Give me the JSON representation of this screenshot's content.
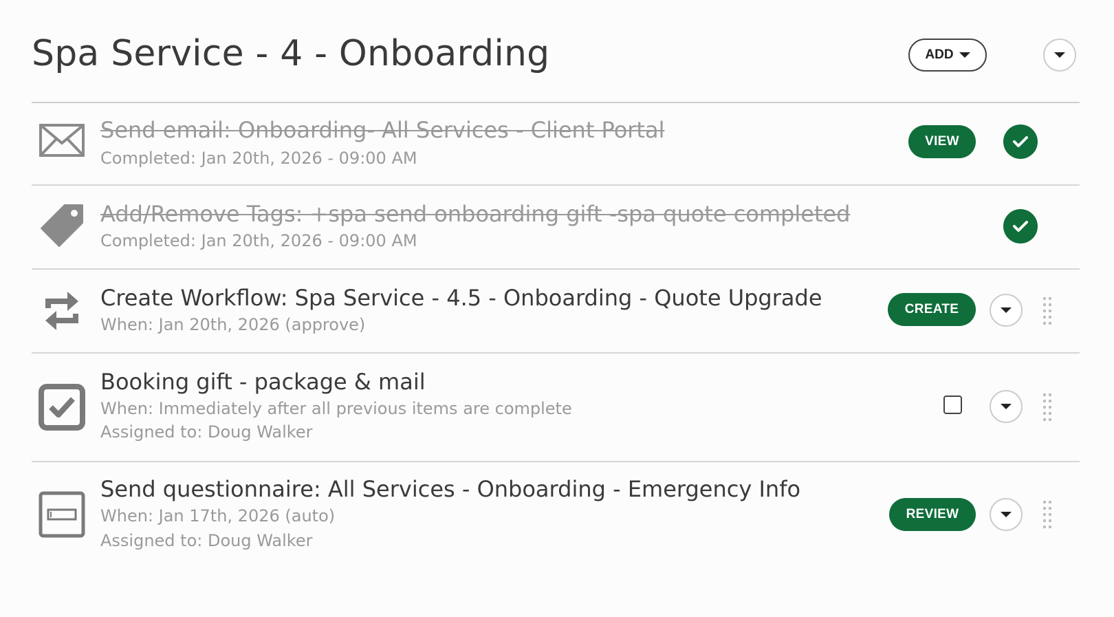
{
  "header": {
    "title": "Spa Service - 4 - Onboarding",
    "add_label": "ADD"
  },
  "colors": {
    "accent_green": "#0f6e3a",
    "completed_text": "#999999"
  },
  "items": [
    {
      "icon": "envelope-icon",
      "title": "Send email: Onboarding- All Services - Client Portal",
      "line1": "Completed: Jan 20th, 2026 - 09:00 AM",
      "action_label": "VIEW",
      "completed": true
    },
    {
      "icon": "tag-icon",
      "title": "Add/Remove Tags: +spa send onboarding gift -spa quote completed",
      "line1": "Completed: Jan 20th, 2026 - 09:00 AM",
      "completed": true
    },
    {
      "icon": "workflow-repeat-icon",
      "title": "Create Workflow: Spa Service - 4.5 - Onboarding - Quote Upgrade",
      "line1": "When: Jan 20th, 2026 (approve)",
      "action_label": "CREATE",
      "completed": false
    },
    {
      "icon": "checkbox-task-icon",
      "title": "Booking gift - package & mail",
      "line1": "When: Immediately after all previous items are complete",
      "line2": "Assigned to: Doug Walker",
      "checked": false,
      "completed": false
    },
    {
      "icon": "questionnaire-form-icon",
      "title": "Send questionnaire: All Services - Onboarding - Emergency Info",
      "line1": "When: Jan 17th, 2026 (auto)",
      "line2": "Assigned to: Doug Walker",
      "action_label": "REVIEW",
      "completed": false
    }
  ]
}
